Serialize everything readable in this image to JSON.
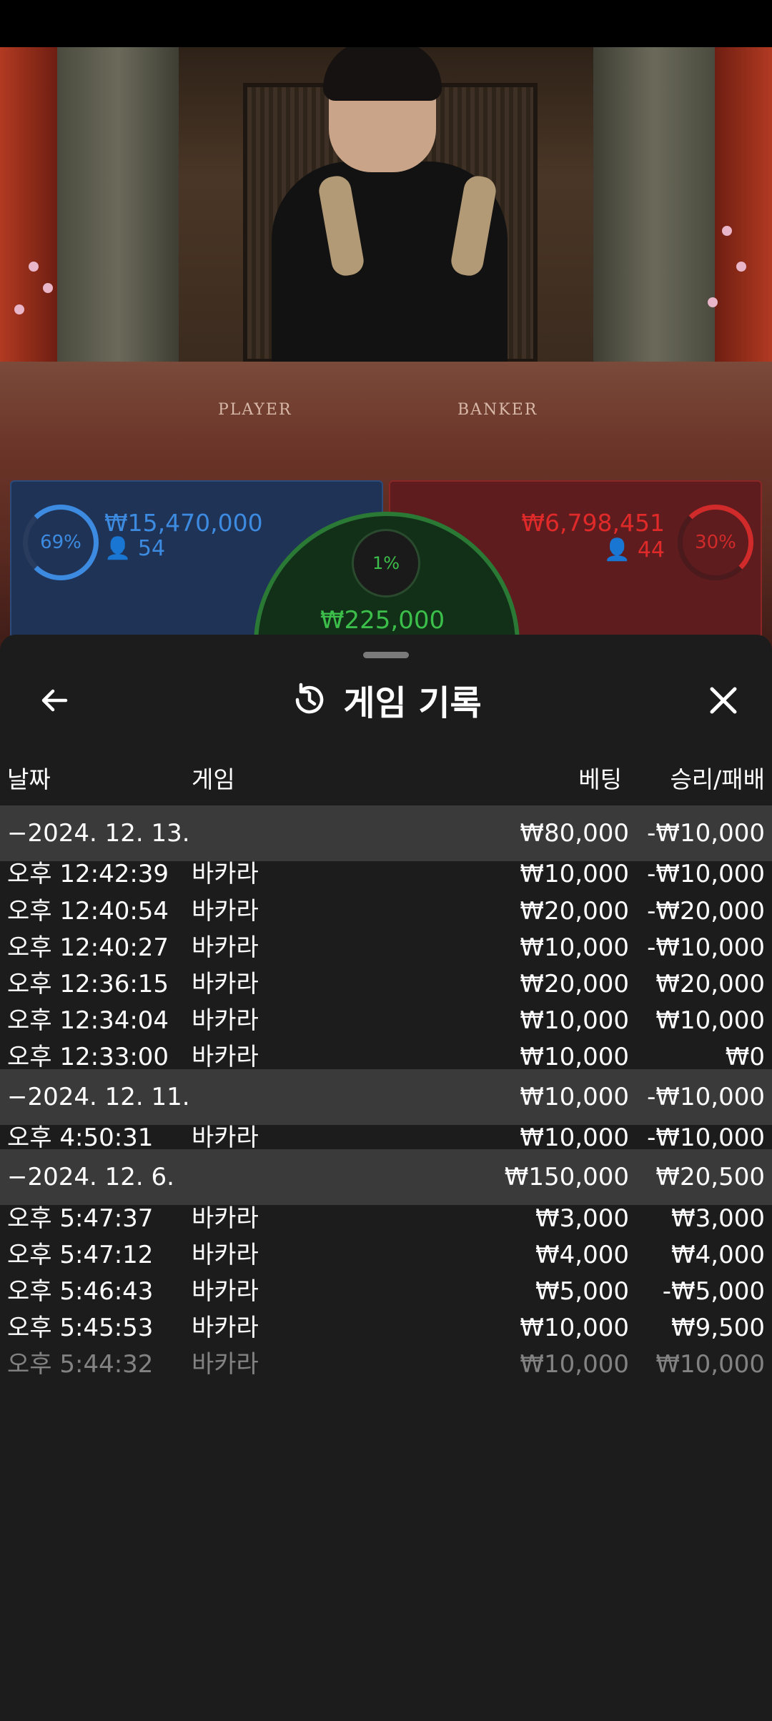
{
  "table_labels": {
    "player": "PLAYER",
    "banker": "BANKER"
  },
  "bets": {
    "player": {
      "percent": "69%",
      "amount": "₩15,470,000",
      "count": "54"
    },
    "banker": {
      "percent": "30%",
      "amount": "₩6,798,451",
      "count": "44"
    },
    "tie": {
      "percent": "1%",
      "amount": "₩225,000"
    }
  },
  "sheet": {
    "title": "게임 기록",
    "back_icon": "arrow-left-icon",
    "history_icon": "history-icon",
    "close_icon": "close-icon",
    "columns": {
      "date": "날짜",
      "game": "게임",
      "bet": "베팅",
      "result": "승리/패배"
    },
    "rows": [
      {
        "type": "group",
        "date": "−2024. 12. 13.",
        "game": "",
        "bet": "₩80,000",
        "result": "-₩10,000"
      },
      {
        "type": "item",
        "date": "오후 12:42:39",
        "game": "바카라",
        "bet": "₩10,000",
        "result": "-₩10,000"
      },
      {
        "type": "item",
        "date": "오후 12:40:54",
        "game": "바카라",
        "bet": "₩20,000",
        "result": "-₩20,000"
      },
      {
        "type": "item",
        "date": "오후 12:40:27",
        "game": "바카라",
        "bet": "₩10,000",
        "result": "-₩10,000"
      },
      {
        "type": "item",
        "date": "오후 12:36:15",
        "game": "바카라",
        "bet": "₩20,000",
        "result": "₩20,000"
      },
      {
        "type": "item",
        "date": "오후 12:34:04",
        "game": "바카라",
        "bet": "₩10,000",
        "result": "₩10,000"
      },
      {
        "type": "item",
        "date": "오후 12:33:00",
        "game": "바카라",
        "bet": "₩10,000",
        "result": "₩0"
      },
      {
        "type": "group",
        "date": "−2024. 12. 11.",
        "game": "",
        "bet": "₩10,000",
        "result": "-₩10,000"
      },
      {
        "type": "item",
        "date": "오후 4:50:31",
        "game": "바카라",
        "bet": "₩10,000",
        "result": "-₩10,000"
      },
      {
        "type": "group",
        "date": "−2024. 12. 6.",
        "game": "",
        "bet": "₩150,000",
        "result": "₩20,500"
      },
      {
        "type": "item",
        "date": "오후 5:47:37",
        "game": "바카라",
        "bet": "₩3,000",
        "result": "₩3,000"
      },
      {
        "type": "item",
        "date": "오후 5:47:12",
        "game": "바카라",
        "bet": "₩4,000",
        "result": "₩4,000"
      },
      {
        "type": "item",
        "date": "오후 5:46:43",
        "game": "바카라",
        "bet": "₩5,000",
        "result": "-₩5,000"
      },
      {
        "type": "item",
        "date": "오후 5:45:53",
        "game": "바카라",
        "bet": "₩10,000",
        "result": "₩9,500"
      },
      {
        "type": "item",
        "date": "오후 5:44:32",
        "game": "바카라",
        "bet": "₩10,000",
        "result": "₩10,000"
      }
    ]
  }
}
